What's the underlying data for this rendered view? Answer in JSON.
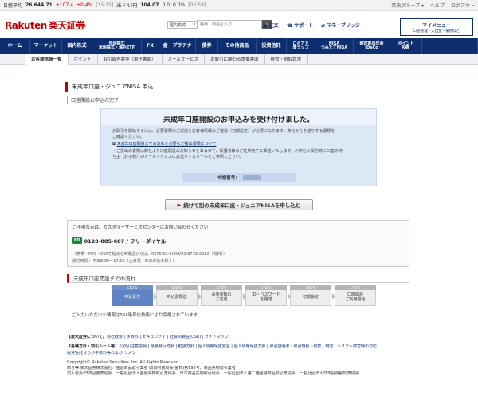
{
  "ticker": {
    "nikkei_label": "日経平均",
    "nikkei_value": "26,644.71",
    "nikkei_change": "+107.4",
    "nikkei_pct": "+0.4%",
    "nikkei_time": "[15:15]",
    "usd_label": "米ドル/円",
    "usd_value": "104.07",
    "usd_change": "0.0",
    "usd_pct": "0.0%",
    "usd_time": "[06:59]",
    "group_link": "楽天グループ ▾",
    "help_link": "ヘルプ",
    "logout_link": "ログアウト"
  },
  "header": {
    "logo": "Rakuten",
    "logo_sub": "楽天証券",
    "search_placeholder": "銘柄・用語を入力",
    "search_type": "国内株式",
    "notice_link": "注文",
    "support_link": "サポート",
    "manebuddy_link": "マネーブリッジ",
    "mymenu_title": "マイメニュー",
    "mymenu_sub": "口座管理・入出金・振替など"
  },
  "mainnav": [
    {
      "label": "ホーム",
      "w": 38
    },
    {
      "label": "マーケット",
      "w": 40
    },
    {
      "label": "国内株式",
      "w": 38
    },
    {
      "label": "外国株式\n米国株式・海外ETF",
      "w": 62
    },
    {
      "label": "FX",
      "w": 22
    },
    {
      "label": "金・プラチナ",
      "w": 46
    },
    {
      "label": "債券",
      "w": 28
    },
    {
      "label": "その他商品",
      "w": 48
    },
    {
      "label": "投資信託",
      "w": 38
    },
    {
      "label": "ロボアド\n楽ラップ",
      "w": 36
    },
    {
      "label": "NISA\nつみたてNISA",
      "w": 48
    },
    {
      "label": "確定拠出年金\niDeCo",
      "w": 46
    },
    {
      "label": "ポイント\n投資",
      "w": 40
    },
    {
      "label": "",
      "w": 70
    }
  ],
  "subnav": [
    "お客様情報一覧",
    "ポイント",
    "取引報告書等（電子書面）",
    "メールサービス",
    "お取引に関わる重要書面",
    "移管・買取請求"
  ],
  "page": {
    "title": "未成年口座・ジュニアNISA 申込",
    "status": "口座開設お申込み完了"
  },
  "confirm": {
    "heading": "未成年口座開設のお申込みを受け付けました。",
    "text1": "お取引を開始するには、必要書類のご返送とお客様情報のご登録（初期設定）が必要になります。弊社からお送りする書類を",
    "text1b": "ご確認ください。",
    "link": "未成年口座開設までの流れと必要なご提出書類について",
    "text2": "・ご提出の書類は弊社より口座開設のお知らせとあわせて、保護者様のご住所宛てに郵送いたします。お申込み受付時に口座の持",
    "text2b": "ち主（お子様）のメールアドレスにお送りするメールをご参照ください。",
    "appno_label": "申請番号："
  },
  "button": {
    "again": "続けて別の未成年口座・ジュニアNISAを申し込む"
  },
  "contact": {
    "intro": "ご不明な点は、カスタマーサービスセンターにお問い合わせください",
    "badge": "FD",
    "tel": "0120-885-687 / フリーダイヤル",
    "note1": "（携帯・PHS・050で始まるIP電話からは、0570-02-1004/03-6739-3322（有料））",
    "note2": "受付時間：平日8:30～17:00（土日祝・年末年始を除く）"
  },
  "flow": {
    "title": "未成年口座開設までの流れ",
    "steps": [
      {
        "lab": "STEP1",
        "text": "申込受付",
        "cur": true
      },
      {
        "lab": "STEP2",
        "text": "申込書類送",
        "cur": false
      },
      {
        "lab": "STEP3",
        "text": "必要書類の\nご返送",
        "cur": false
      },
      {
        "lab": "STEP4",
        "text": "ID・パスワード\nを発送",
        "cur": false
      },
      {
        "lab": "STEP5",
        "text": "初期設定",
        "cur": false
      },
      {
        "lab": "STEP6",
        "text": "口座開設\nご利用開始",
        "cur": false
      }
    ]
  },
  "ssl_note": "ご入力いただいた情報はSSL暗号化技術により保護されています。",
  "footer": {
    "about_head": "【楽天証券について】",
    "about_links": "会社概要 | 手数料 | セキュリティ | 社会的責任(CSR) | サイトマップ",
    "rules_head": "【各種方針・取引ルール等】",
    "rules_links": "お取引注意説明 | 最良執行方針 | 勧誘方針 | 個人情報保護宣言 | 個人情報保護方針 | 取引説明書・取引規程・約款・規定 | システム障害時の対応",
    "rules_links2": "投資信託ならび手数料等および リスク",
    "copyright": "Copyright© Rakuten Securities, Inc. All Rights Reserved",
    "reg1": "商号等:楽天証券株式会社／金融商品取引業者 関東財務局長(金商)第195号、商品先物取引業者",
    "reg2": "加入協会:日本証券業協会、一般社団法人金融先物取引業協会、日本商品先物取引協会、一般社団法人第二種金融商品取引業協会、一般社団法人日本投資顧問業協会"
  }
}
